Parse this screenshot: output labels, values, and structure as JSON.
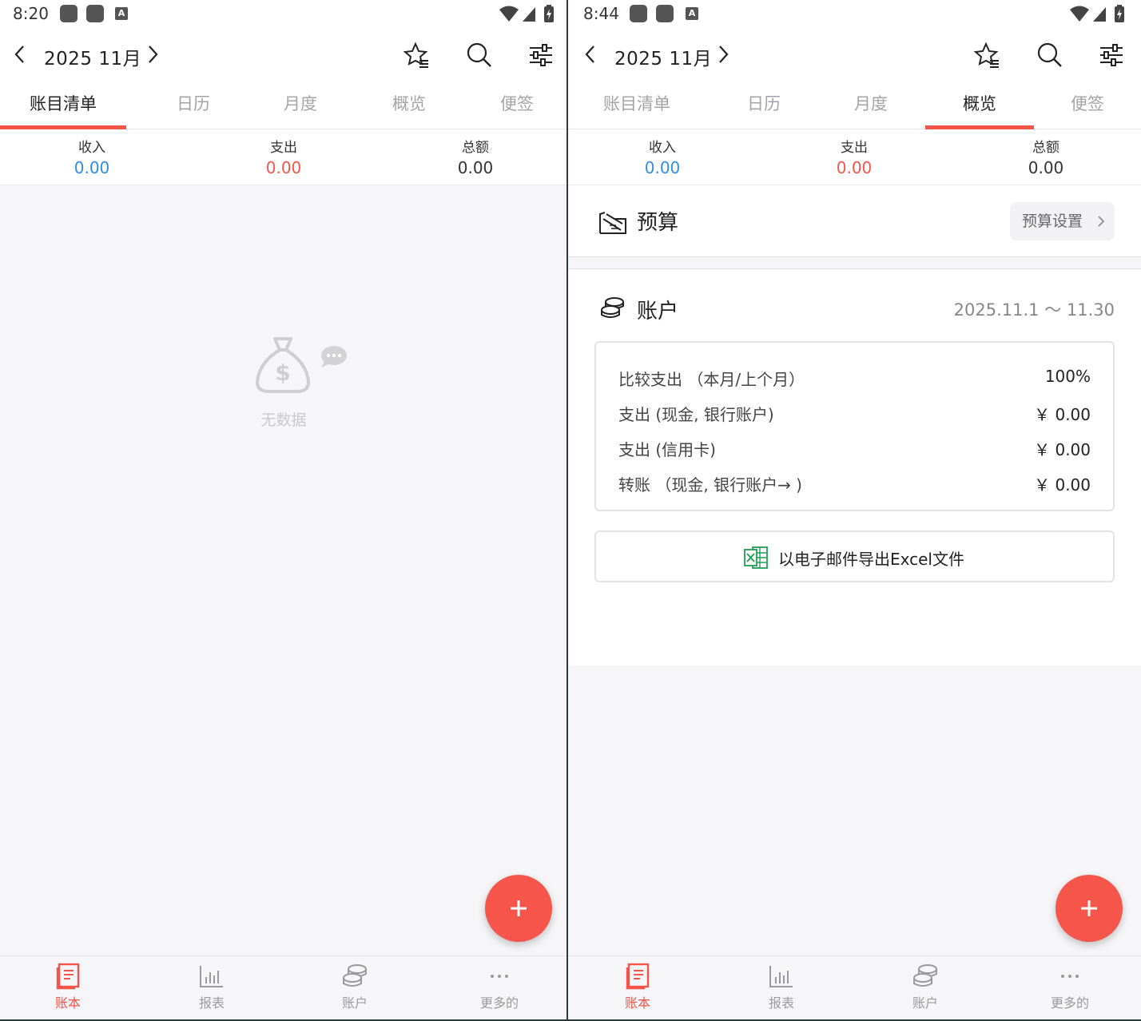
{
  "colors": {
    "accent": "#f2564a",
    "income": "#2e8fe2",
    "expense": "#f2564a",
    "excel": "#1f9d55"
  },
  "left": {
    "status": {
      "time": "8:20",
      "badge": "A"
    },
    "header": {
      "month": "2025 11月"
    },
    "tabs": [
      "账目清单",
      "日历",
      "月度",
      "概览",
      "便签"
    ],
    "active_tab": "账目清单",
    "summary": {
      "income_label": "收入",
      "income_value": "0.00",
      "expense_label": "支出",
      "expense_value": "0.00",
      "total_label": "总额",
      "total_value": "0.00"
    },
    "empty_text": "无数据",
    "nav": [
      "账本",
      "报表",
      "账户",
      "更多的"
    ]
  },
  "right": {
    "status": {
      "time": "8:44",
      "badge": "A"
    },
    "header": {
      "month": "2025 11月"
    },
    "tabs": [
      "账目清单",
      "日历",
      "月度",
      "概览",
      "便签"
    ],
    "active_tab": "概览",
    "summary": {
      "income_label": "收入",
      "income_value": "0.00",
      "expense_label": "支出",
      "expense_value": "0.00",
      "total_label": "总额",
      "total_value": "0.00"
    },
    "budget": {
      "title": "预算",
      "settings_label": "预算设置"
    },
    "accounts": {
      "title": "账户",
      "range": "2025.11.1 ～ 11.30",
      "rows": [
        {
          "label": "比较支出 （本月/上个月）",
          "value": "100%"
        },
        {
          "label": "支出 (现金, 银行账户)",
          "value": "￥ 0.00"
        },
        {
          "label": "支出 (信用卡)",
          "value": "￥ 0.00"
        },
        {
          "label": "转账 （现金, 银行账户→ )",
          "value": "￥ 0.00"
        }
      ],
      "export_label": "以电子邮件导出Excel文件"
    },
    "nav": [
      "账本",
      "报表",
      "账户",
      "更多的"
    ]
  }
}
